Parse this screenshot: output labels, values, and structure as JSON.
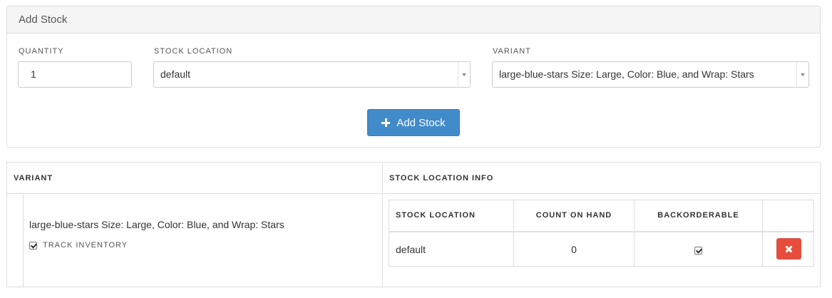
{
  "add_stock_panel": {
    "title": "Add Stock",
    "quantity_label": "QUANTITY",
    "quantity_value": "1",
    "stock_location_label": "STOCK LOCATION",
    "stock_location_value": "default",
    "variant_label": "VARIANT",
    "variant_value": "large-blue-stars Size: Large, Color: Blue, and Wrap: Stars",
    "submit_label": "Add Stock"
  },
  "stock_table": {
    "headers": {
      "variant": "VARIANT",
      "stock_location_info": "STOCK LOCATION INFO"
    },
    "variant_name": "large-blue-stars Size: Large, Color: Blue, and Wrap: Stars",
    "track_inventory_label": "TRACK INVENTORY",
    "track_inventory_checked": true,
    "location_table": {
      "headers": [
        "STOCK LOCATION",
        "COUNT ON HAND",
        "BACKORDERABLE",
        ""
      ],
      "rows": [
        {
          "stock_location": "default",
          "count_on_hand": "0",
          "backorderable": true
        }
      ]
    }
  },
  "icons": {
    "add_button_icon": "plus-icon",
    "delete_button_icon": "close-icon",
    "select_arrow_icon": "chevron-down-icon"
  },
  "colors": {
    "primary": "#428bca",
    "danger": "#e74c3c",
    "panel_heading_bg": "#f5f5f5",
    "border": "#dddddd"
  }
}
